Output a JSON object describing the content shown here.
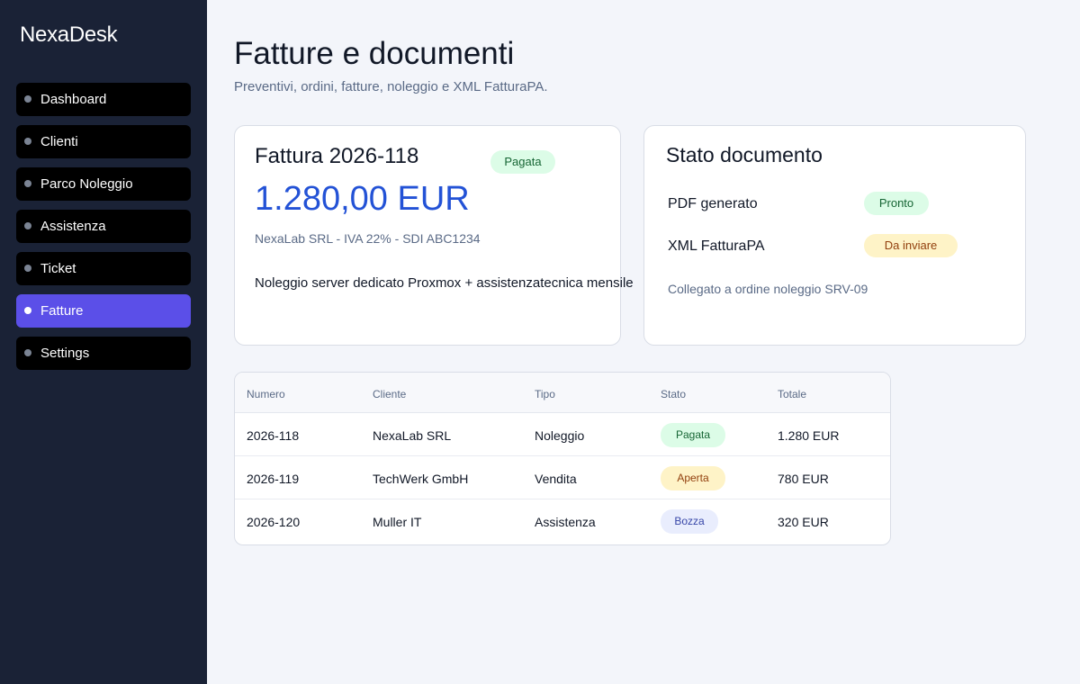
{
  "app": {
    "name": "NexaDesk"
  },
  "sidebar": {
    "items": [
      {
        "label": "Dashboard"
      },
      {
        "label": "Clienti"
      },
      {
        "label": "Parco Noleggio"
      },
      {
        "label": "Assistenza"
      },
      {
        "label": "Ticket"
      },
      {
        "label": "Fatture"
      },
      {
        "label": "Settings"
      }
    ],
    "active_label": "Fatture"
  },
  "page": {
    "title": "Fatture e documenti",
    "subtitle": "Preventivi, ordini, fatture, noleggio e XML FatturaPA."
  },
  "invoice": {
    "title": "Fattura 2026-118",
    "badge": "Pagata",
    "amount": "1.280,00 EUR",
    "meta": "NexaLab SRL - IVA 22% - SDI ABC1234",
    "description": "Noleggio server dedicato Proxmox + assistenzatecnica mensile"
  },
  "document_status": {
    "title": "Stato documento",
    "rows": [
      {
        "label": "PDF generato",
        "badge": "Pronto"
      },
      {
        "label": "XML FatturaPA",
        "badge": "Da inviare"
      }
    ],
    "note": "Collegato a ordine noleggio SRV-09"
  },
  "table": {
    "headers": [
      "Numero",
      "Cliente",
      "Tipo",
      "Stato",
      "Totale"
    ],
    "rows": [
      {
        "numero": "2026-118",
        "cliente": "NexaLab SRL",
        "tipo": "Noleggio",
        "stato": "Pagata",
        "totale": "1.280 EUR"
      },
      {
        "numero": "2026-119",
        "cliente": "TechWerk GmbH",
        "tipo": "Vendita",
        "stato": "Aperta",
        "totale": "780 EUR"
      },
      {
        "numero": "2026-120",
        "cliente": "Muller IT",
        "tipo": "Assistenza",
        "stato": "Bozza",
        "totale": "320 EUR"
      }
    ]
  },
  "colors": {
    "sidebar_bg": "#1a2236",
    "active_nav": "#5b4fe8",
    "amount_blue": "#2352d6",
    "badge_green": "#dcfce7",
    "badge_amber": "#fef3c7",
    "badge_blue": "#e9edfd"
  }
}
